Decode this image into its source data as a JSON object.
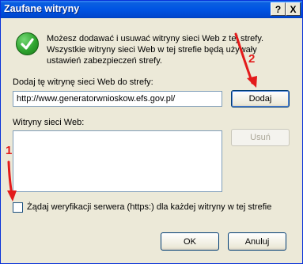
{
  "window": {
    "title": "Zaufane witryny",
    "help_glyph": "?",
    "close_glyph": "X"
  },
  "info": {
    "icon": "check-shield-icon",
    "line1": "Możesz dodawać i usuwać witryny sieci Web z tej strefy.",
    "line2": "Wszystkie witryny sieci Web w tej strefie będą używały",
    "line3": "ustawień zabezpieczeń strefy."
  },
  "add_site": {
    "label": "Dodaj tę witrynę sieci Web do strefy:",
    "value": "http://www.generatorwnioskow.efs.gov.pl/",
    "add_button": "Dodaj"
  },
  "sites": {
    "label": "Witryny sieci Web:",
    "items": [],
    "remove_button": "Usuń"
  },
  "verification": {
    "label": "Żądaj weryfikacji serwera (https:) dla każdej witryny w tej strefie",
    "checked": false
  },
  "footer": {
    "ok": "OK",
    "cancel": "Anuluj"
  },
  "annotations": {
    "marker1": "1",
    "marker2": "2",
    "color": "#e31b1b"
  },
  "colors": {
    "titlebar": "#0054e3",
    "dialog_bg": "#ece9d8",
    "field_border": "#7f9db9"
  }
}
